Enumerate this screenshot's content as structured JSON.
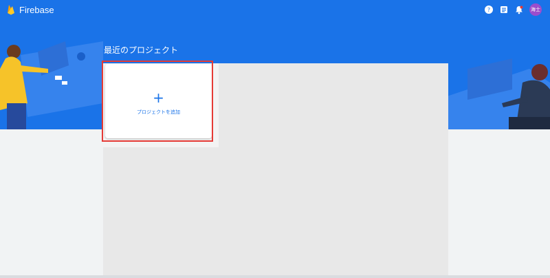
{
  "app": {
    "name": "Firebase"
  },
  "header": {
    "icons": [
      "help-icon",
      "notes-icon",
      "notifications-icon"
    ],
    "avatar_text": "海士"
  },
  "main": {
    "section_title": "最近のプロジェクト",
    "add_card": {
      "icon": "+",
      "label": "プロジェクトを追加"
    }
  },
  "colors": {
    "brand_blue": "#1a73e8",
    "highlight_red": "#e53a35",
    "avatar_purple": "#9c4dcc"
  }
}
